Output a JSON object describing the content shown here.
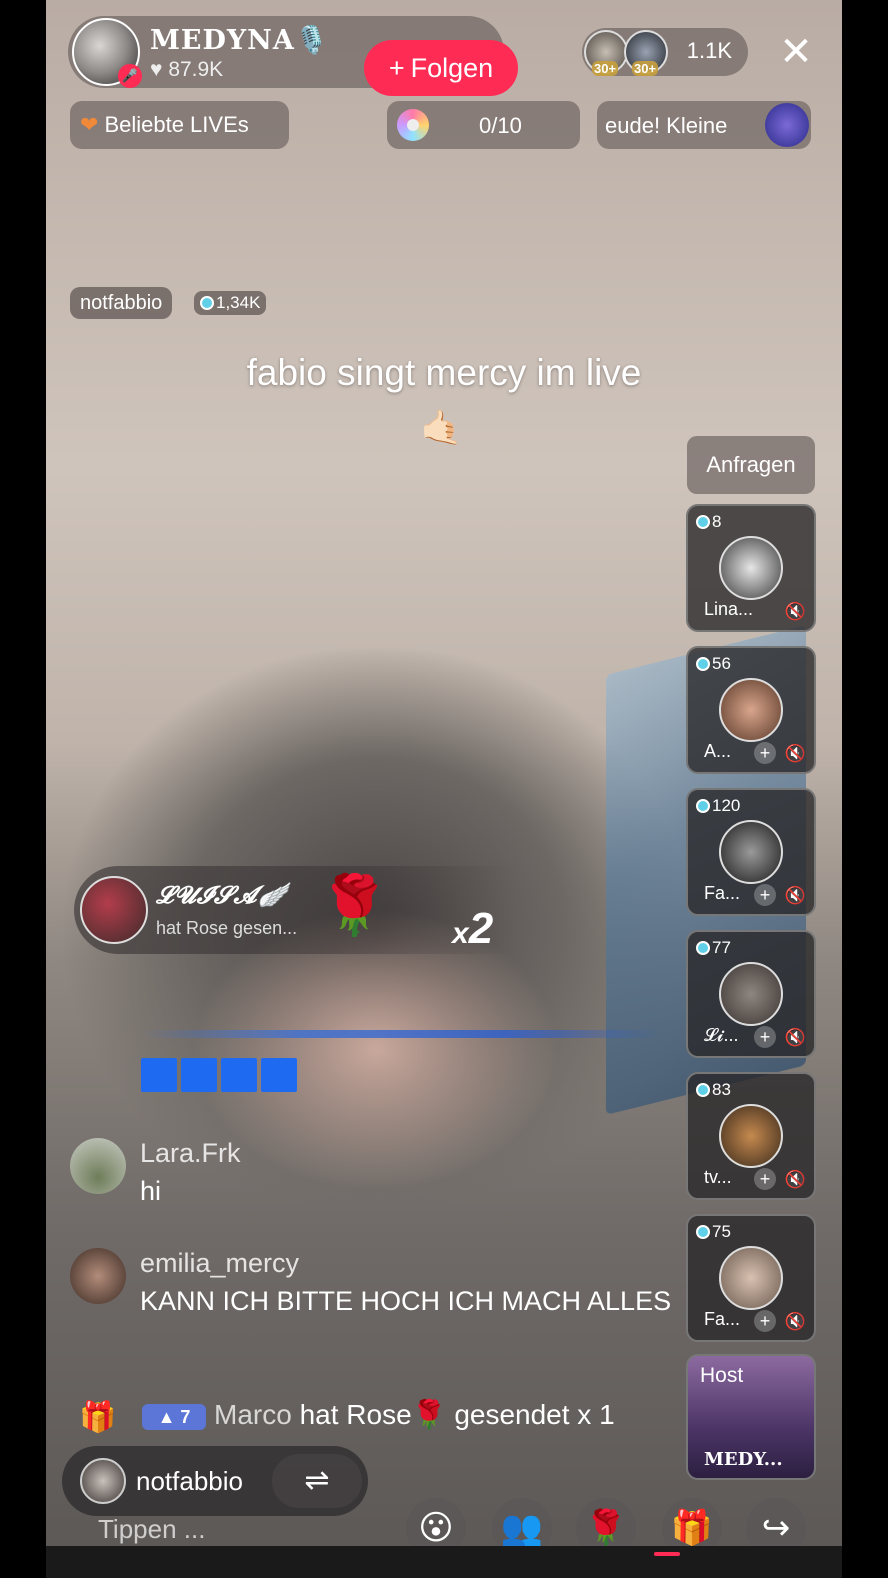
{
  "host": {
    "name": "MEDYNA",
    "name_icon": "🎙️",
    "likes": "87.9K",
    "follow_label": "Folgen",
    "mic_muted": true
  },
  "viewers": {
    "badge1": "30+",
    "badge2": "30+",
    "count": "1.1K"
  },
  "close_icon": "✕",
  "top_row": {
    "popular_label": "Beliebte LIVEs",
    "goal_progress": "0/10",
    "ticker_text": "eude!    Kleine"
  },
  "co_host_tag": {
    "name": "notfabbio",
    "diamonds": "1,34K"
  },
  "caption": "fabio singt mercy im live",
  "caption_emoji": "🤙🏻",
  "requests_label": "Anfragen",
  "guests": [
    {
      "score": "8",
      "name": "Lina...",
      "has_add": false
    },
    {
      "score": "56",
      "name": "A...",
      "has_add": true
    },
    {
      "score": "120",
      "name": "Fa...",
      "has_add": true
    },
    {
      "score": "77",
      "name": "𝓛𝓲...",
      "has_add": true
    },
    {
      "score": "83",
      "name": "tv...",
      "has_add": true
    },
    {
      "score": "75",
      "name": "Fa...",
      "has_add": true
    }
  ],
  "host_tile": {
    "label": "Host",
    "name": "MEDY..."
  },
  "gift_banner": {
    "user": "𝓛𝓤𝓘𝓢𝓐🪽",
    "subtitle": "hat Rose  gesen...",
    "gift_icon": "🌹",
    "x": "x",
    "count": "2"
  },
  "comments": [
    {
      "user": "Lara.Frk",
      "text": "hi"
    },
    {
      "user": "emilia_mercy",
      "text": "KANN ICH BITTE HOCH ICH MACH ALLES"
    }
  ],
  "gift_line": {
    "level": "7",
    "user": "Marco",
    "action": "hat Rose",
    "gift_icon": "🌹",
    "suffix": "gesendet x 1"
  },
  "co_host_pill": {
    "name": "notfabbio",
    "switch_icon": "⇌"
  },
  "input_placeholder": "Tippen ...",
  "bottom_icons": [
    "😮",
    "👥",
    "🌹",
    "🎁",
    "↪"
  ],
  "colors": {
    "accent": "#fe2c55",
    "level_badge": "#5c76d8"
  }
}
